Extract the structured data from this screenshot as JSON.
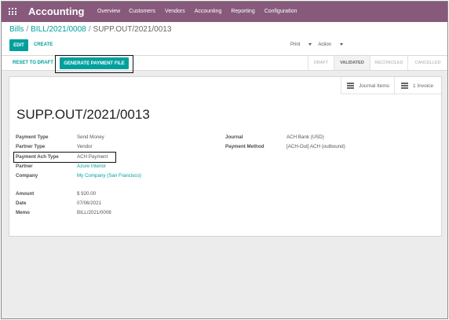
{
  "navbar": {
    "brand": "Accounting",
    "menu": [
      "Overview",
      "Customers",
      "Vendors",
      "Accounting",
      "Reporting",
      "Configuration"
    ]
  },
  "breadcrumb": {
    "parent": "Bills",
    "bill": "BILL/2021/0008",
    "current": "SUPP.OUT/2021/0013",
    "separator": "/"
  },
  "toolbar": {
    "edit_label": "EDIT",
    "create_label": "CREATE",
    "print_label": "Print",
    "action_label": "Action"
  },
  "statusbar": {
    "reset_label": "RESET TO DRAFT",
    "generate_label": "GENERATE PAYMENT FILE",
    "stages": [
      {
        "label": "DRAFT",
        "current": false
      },
      {
        "label": "VALIDATED",
        "current": true
      },
      {
        "label": "RECONCILED",
        "current": false
      },
      {
        "label": "CANCELLED",
        "current": false
      }
    ]
  },
  "smart_buttons": {
    "journal_items": "Journal Items",
    "invoice_count": "1",
    "invoice_label": "Invoice"
  },
  "record": {
    "title": "SUPP.OUT/2021/0013",
    "left_fields": [
      {
        "label": "Payment Type",
        "value": "Send Money",
        "link": false
      },
      {
        "label": "Partner Type",
        "value": "Vendor",
        "link": false
      },
      {
        "label": "Payment Ach Type",
        "value": "ACH Payment",
        "link": false
      },
      {
        "label": "Partner",
        "value": "Azure Interior",
        "link": true
      },
      {
        "label": "Company",
        "value": "My Company (San Francisco)",
        "link": true
      },
      {
        "label": "Amount",
        "value": "$ 920.00",
        "link": false
      },
      {
        "label": "Date",
        "value": "07/06/2021",
        "link": false
      },
      {
        "label": "Memo",
        "value": "BILL/2021/0008",
        "link": false
      }
    ],
    "right_fields": [
      {
        "label": "Journal",
        "value": "ACH Bank (USD)"
      },
      {
        "label": "Payment Method",
        "value": "[ACH-Out] ACH (outbound)"
      }
    ]
  },
  "colors": {
    "navbar": "#875a7b",
    "accent": "#00a09d"
  }
}
